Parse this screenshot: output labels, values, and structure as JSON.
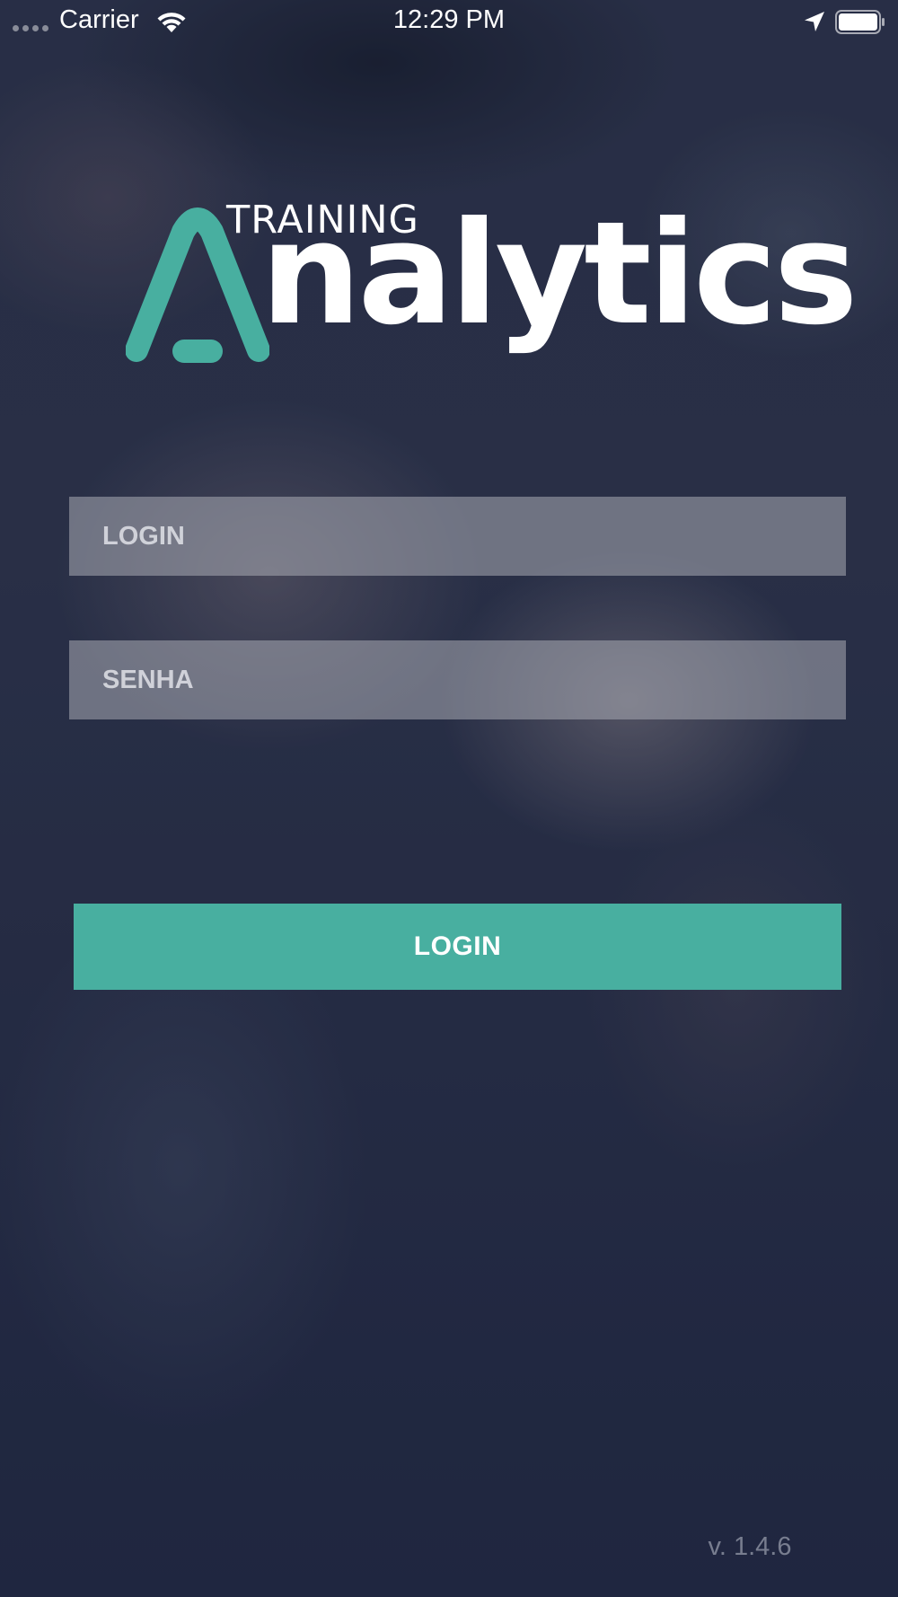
{
  "status_bar": {
    "carrier": "Carrier",
    "time": "12:29 PM"
  },
  "logo": {
    "line_small": "TRAINING",
    "line_large": "nalytics",
    "accent_color": "#48afa0"
  },
  "form": {
    "login_placeholder": "LOGIN",
    "login_value": "",
    "password_placeholder": "SENHA",
    "password_value": "",
    "submit_label": "LOGIN",
    "submit_color": "#48afa0"
  },
  "footer": {
    "version": "v. 1.4.6"
  },
  "icons": [
    "signal-icon",
    "wifi-icon",
    "location-icon",
    "battery-icon"
  ]
}
